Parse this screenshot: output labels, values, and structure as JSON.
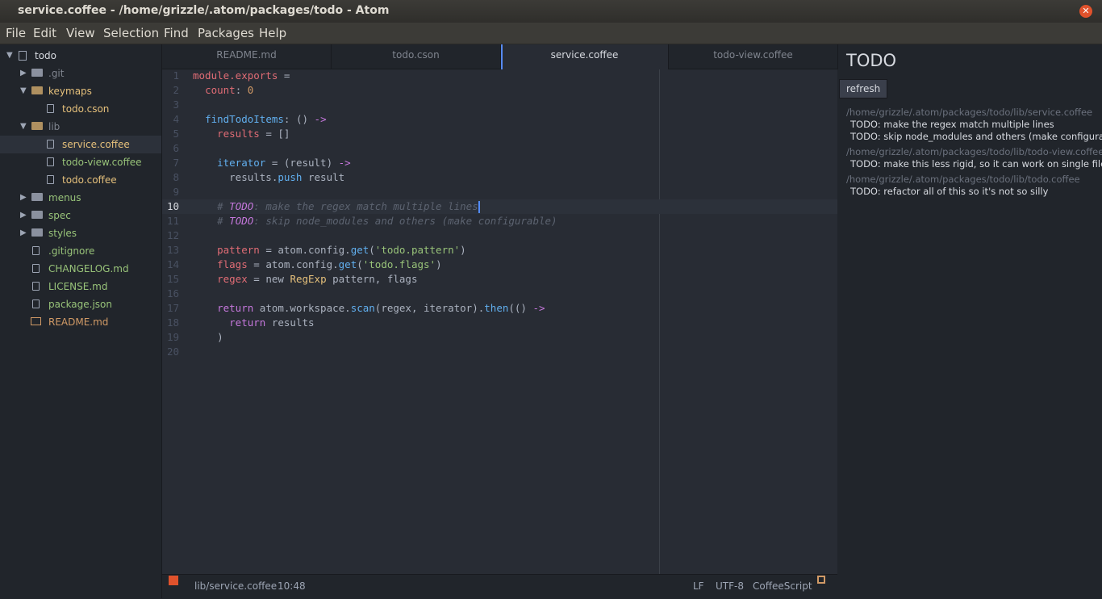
{
  "window": {
    "title": "service.coffee - /home/grizzle/.atom/packages/todo - Atom",
    "close_glyph": "✕"
  },
  "menu": [
    "File",
    "Edit",
    "View",
    "Selection",
    "Find",
    "Packages",
    "Help"
  ],
  "tree": {
    "root": "todo",
    "items": [
      {
        "label": ".git",
        "kind": "folder",
        "expanded": false,
        "color": "grey"
      },
      {
        "label": "keymaps",
        "kind": "folder",
        "expanded": true,
        "color": "yellow"
      },
      {
        "label": "todo.cson",
        "kind": "file",
        "color": "yellow"
      },
      {
        "label": "lib",
        "kind": "folder",
        "expanded": true,
        "color": "grey"
      },
      {
        "label": "service.coffee",
        "kind": "file",
        "color": "yellow",
        "selected": true
      },
      {
        "label": "todo-view.coffee",
        "kind": "file",
        "color": "green"
      },
      {
        "label": "todo.coffee",
        "kind": "file",
        "color": "yellow"
      },
      {
        "label": "menus",
        "kind": "folder",
        "expanded": false,
        "color": "green"
      },
      {
        "label": "spec",
        "kind": "folder",
        "expanded": false,
        "color": "green"
      },
      {
        "label": "styles",
        "kind": "folder",
        "expanded": false,
        "color": "green"
      },
      {
        "label": ".gitignore",
        "kind": "file",
        "color": "green"
      },
      {
        "label": "CHANGELOG.md",
        "kind": "file",
        "color": "green"
      },
      {
        "label": "LICENSE.md",
        "kind": "file",
        "color": "green"
      },
      {
        "label": "package.json",
        "kind": "file",
        "color": "green"
      },
      {
        "label": "README.md",
        "kind": "book",
        "color": "orange"
      }
    ]
  },
  "tabs": [
    {
      "label": "README.md",
      "active": false
    },
    {
      "label": "todo.cson",
      "active": false
    },
    {
      "label": "service.coffee",
      "active": true
    },
    {
      "label": "todo-view.coffee",
      "active": false
    }
  ],
  "editor": {
    "cursor_line": 10,
    "lines": [
      {
        "n": "1",
        "tokens": [
          [
            "var",
            "module.exports"
          ],
          [
            "op",
            " ="
          ]
        ]
      },
      {
        "n": "2",
        "tokens": [
          [
            "op",
            "  "
          ],
          [
            "var",
            "count"
          ],
          [
            "op",
            ": "
          ],
          [
            "num",
            "0"
          ]
        ]
      },
      {
        "n": "3",
        "tokens": []
      },
      {
        "n": "4",
        "tokens": [
          [
            "op",
            "  "
          ],
          [
            "fn",
            "findTodoItems"
          ],
          [
            "op",
            ": () "
          ],
          [
            "kw",
            "->"
          ]
        ]
      },
      {
        "n": "5",
        "tokens": [
          [
            "op",
            "    "
          ],
          [
            "var",
            "results"
          ],
          [
            "op",
            " = []"
          ]
        ]
      },
      {
        "n": "6",
        "tokens": []
      },
      {
        "n": "7",
        "tokens": [
          [
            "op",
            "    "
          ],
          [
            "fn",
            "iterator"
          ],
          [
            "op",
            " = (result) "
          ],
          [
            "kw",
            "->"
          ]
        ]
      },
      {
        "n": "8",
        "tokens": [
          [
            "op",
            "      results."
          ],
          [
            "fn",
            "push"
          ],
          [
            "op",
            " result"
          ]
        ]
      },
      {
        "n": "9",
        "tokens": []
      },
      {
        "n": "10",
        "tokens": [
          [
            "op",
            "    "
          ],
          [
            "cm",
            "# "
          ],
          [
            "todo",
            "TODO"
          ],
          [
            "cm",
            ": make the regex match multiple lines"
          ]
        ],
        "cursor": true
      },
      {
        "n": "11",
        "tokens": [
          [
            "op",
            "    "
          ],
          [
            "cm",
            "# "
          ],
          [
            "todo",
            "TODO"
          ],
          [
            "cm",
            ": skip node_modules and others (make configurable)"
          ]
        ]
      },
      {
        "n": "12",
        "tokens": []
      },
      {
        "n": "13",
        "tokens": [
          [
            "op",
            "    "
          ],
          [
            "var",
            "pattern"
          ],
          [
            "op",
            " = atom.config."
          ],
          [
            "fn",
            "get"
          ],
          [
            "op",
            "("
          ],
          [
            "str",
            "'todo.pattern'"
          ],
          [
            "op",
            ")"
          ]
        ]
      },
      {
        "n": "14",
        "tokens": [
          [
            "op",
            "    "
          ],
          [
            "var",
            "flags"
          ],
          [
            "op",
            " = atom.config."
          ],
          [
            "fn",
            "get"
          ],
          [
            "op",
            "("
          ],
          [
            "str",
            "'todo.flags'"
          ],
          [
            "op",
            ")"
          ]
        ]
      },
      {
        "n": "15",
        "tokens": [
          [
            "op",
            "    "
          ],
          [
            "var",
            "regex"
          ],
          [
            "op",
            " = new "
          ],
          [
            "cls",
            "RegExp"
          ],
          [
            "op",
            " pattern, flags"
          ]
        ]
      },
      {
        "n": "16",
        "tokens": []
      },
      {
        "n": "17",
        "tokens": [
          [
            "op",
            "    "
          ],
          [
            "kw",
            "return"
          ],
          [
            "op",
            " atom.workspace."
          ],
          [
            "fn",
            "scan"
          ],
          [
            "op",
            "(regex, iterator)."
          ],
          [
            "fn",
            "then"
          ],
          [
            "op",
            "(() "
          ],
          [
            "kw",
            "->"
          ]
        ]
      },
      {
        "n": "18",
        "tokens": [
          [
            "op",
            "      "
          ],
          [
            "kw",
            "return"
          ],
          [
            "op",
            " results"
          ]
        ]
      },
      {
        "n": "19",
        "tokens": [
          [
            "op",
            "    )"
          ]
        ]
      },
      {
        "n": "20",
        "tokens": []
      }
    ]
  },
  "status": {
    "path": "lib/service.coffee",
    "position": "10:48",
    "line_ending": "LF",
    "encoding": "UTF-8",
    "grammar": "CoffeeScript"
  },
  "todo_panel": {
    "heading": "TODO",
    "refresh_label": "refresh",
    "groups": [
      {
        "file": "/home/grizzle/.atom/packages/todo/lib/service.coffee",
        "items": [
          "TODO: make the regex match multiple lines",
          "TODO: skip node_modules and others (make configurable)"
        ]
      },
      {
        "file": "/home/grizzle/.atom/packages/todo/lib/todo-view.coffee",
        "items": [
          "TODO: make this less rigid, so it can work on single files"
        ]
      },
      {
        "file": "/home/grizzle/.atom/packages/todo/lib/todo.coffee",
        "items": [
          "TODO: refactor all of this so it's not so silly"
        ]
      }
    ]
  }
}
